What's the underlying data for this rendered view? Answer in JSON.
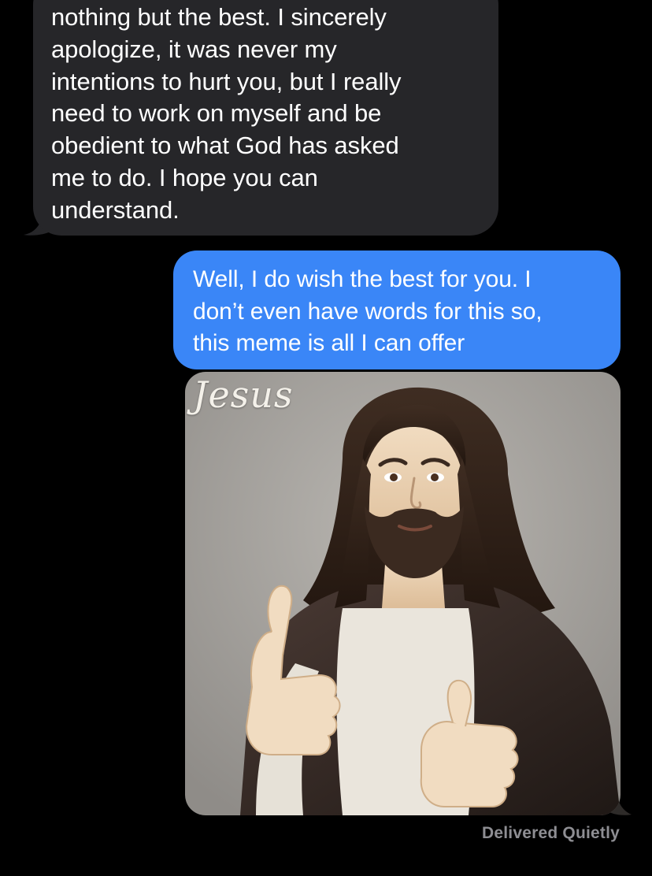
{
  "conversation": {
    "incoming_message": {
      "text": "nothing but the best. I sincerely\napologize, it was never my\nintentions to hurt you, but I really\nneed to work on myself and be\nobedient to what God has asked\nme to do. I hope you can\nunderstand."
    },
    "outgoing_message": {
      "text": "Well, I do wish the best for you. I\ndon’t even have words for this so,\nthis meme is all I can offer"
    },
    "image_message": {
      "caption": "Jesus",
      "icon": "thumbs-up-jesus-meme-image"
    },
    "delivery_status": "Delivered Quietly"
  },
  "colors": {
    "background": "#000000",
    "incoming_bubble": "#262629",
    "outgoing_bubble": "#3a86f7",
    "status_text": "#8e8e93"
  }
}
